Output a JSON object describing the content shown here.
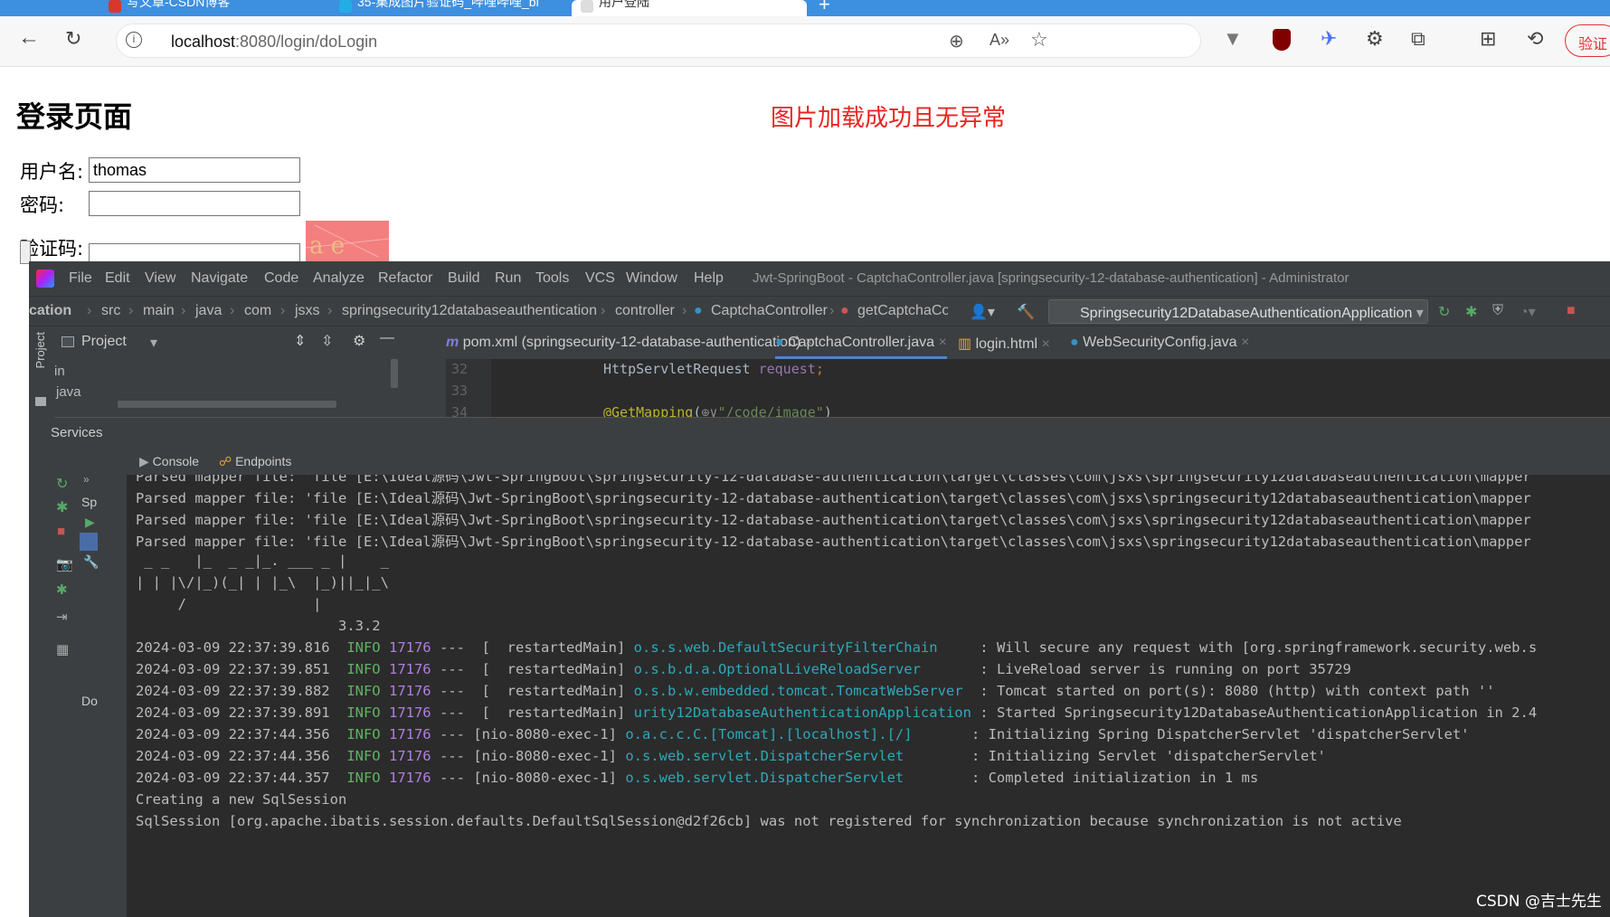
{
  "browser": {
    "tabs": [
      {
        "label": "写文章-CSDN博客",
        "color": "#d9372b"
      },
      {
        "label": "35-集成图片验证码_哔哩哔哩_bi",
        "color": "#23ade5"
      },
      {
        "label": "用户登陆",
        "color": "#cccccc"
      }
    ],
    "url_host": "localhost",
    "url_rest": ":8080/login/doLogin",
    "verify_label": "验证"
  },
  "page": {
    "title": "登录页面",
    "message": "图片加载成功且无异常",
    "username_label": "用户名:",
    "username_value": "thomas",
    "password_label": "密码:",
    "captcha_label": "验证码:",
    "captcha_text": "a e"
  },
  "ide": {
    "menu": [
      "File",
      "Edit",
      "View",
      "Navigate",
      "Code",
      "Analyze",
      "Refactor",
      "Build",
      "Run",
      "Tools",
      "VCS",
      "Window",
      "Help"
    ],
    "title": "Jwt-SpringBoot - CaptchaController.java [springsecurity-12-database-authentication] - Administrator",
    "breadcrumbs": [
      "cation",
      "src",
      "main",
      "java",
      "com",
      "jsxs",
      "springsecurity12databaseauthentication",
      "controller",
      "CaptchaController",
      "getCaptchaCod"
    ],
    "run_config": "Springsecurity12DatabaseAuthenticationApplication",
    "project_label": "Project",
    "editor_tabs": [
      "pom.xml (springsecurity-12-database-authentication)",
      "CaptchaController.java",
      "login.html",
      "WebSecurityConfig.java"
    ],
    "tree": [
      "in",
      "java"
    ],
    "code_lines": [
      {
        "num": "32",
        "text": "HttpServletRequest request;"
      },
      {
        "num": "33",
        "text": ""
      },
      {
        "num": "34",
        "text": "@GetMapping(\"/code/image\")"
      }
    ],
    "services_label": "Services",
    "console_label": "Console",
    "endpoints_label": "Endpoints",
    "svc_sp": "Sp",
    "svc_do": "Do",
    "side_project": "Project"
  },
  "console": {
    "mapper_lines": [
      "Parsed mapper file: 'file [E:\\Ideal源码\\Jwt-SpringBoot\\springsecurity-12-database-authentication\\target\\classes\\com\\jsxs\\springsecurity12databaseauthentication\\mapper",
      "Parsed mapper file: 'file [E:\\Ideal源码\\Jwt-SpringBoot\\springsecurity-12-database-authentication\\target\\classes\\com\\jsxs\\springsecurity12databaseauthentication\\mapper",
      "Parsed mapper file: 'file [E:\\Ideal源码\\Jwt-SpringBoot\\springsecurity-12-database-authentication\\target\\classes\\com\\jsxs\\springsecurity12databaseauthentication\\mapper",
      "Parsed mapper file: 'file [E:\\Ideal源码\\Jwt-SpringBoot\\springsecurity-12-database-authentication\\target\\classes\\com\\jsxs\\springsecurity12databaseauthentication\\mapper"
    ],
    "banner": [
      " _ _   |_  _ _|_. ___ _ |    _",
      "| | |\\/|_)(_| | |_\\  |_)||_|_\\",
      "     /               |",
      "                        3.3.2"
    ],
    "logs": [
      {
        "ts": "2024-03-09 22:37:39.816",
        "level": "INFO",
        "pid": "17176",
        "thread": "---  [  restartedMain]",
        "logger": "o.s.s.web.DefaultSecurityFilterChain    ",
        "msg": ": Will secure any request with [org.springframework.security.web.s"
      },
      {
        "ts": "2024-03-09 22:37:39.851",
        "level": "INFO",
        "pid": "17176",
        "thread": "---  [  restartedMain]",
        "logger": "o.s.b.d.a.OptionalLiveReloadServer      ",
        "msg": ": LiveReload server is running on port 35729"
      },
      {
        "ts": "2024-03-09 22:37:39.882",
        "level": "INFO",
        "pid": "17176",
        "thread": "---  [  restartedMain]",
        "logger": "o.s.b.w.embedded.tomcat.TomcatWebServer ",
        "msg": ": Tomcat started on port(s): 8080 (http) with context path ''"
      },
      {
        "ts": "2024-03-09 22:37:39.891",
        "level": "INFO",
        "pid": "17176",
        "thread": "---  [  restartedMain]",
        "logger": "urity12DatabaseAuthenticationApplication",
        "msg": ": Started Springsecurity12DatabaseAuthenticationApplication in 2.4"
      },
      {
        "ts": "2024-03-09 22:37:44.356",
        "level": "INFO",
        "pid": "17176",
        "thread": "--- [nio-8080-exec-1]",
        "logger": "o.a.c.c.C.[Tomcat].[localhost].[/]      ",
        "msg": ": Initializing Spring DispatcherServlet 'dispatcherServlet'"
      },
      {
        "ts": "2024-03-09 22:37:44.356",
        "level": "INFO",
        "pid": "17176",
        "thread": "--- [nio-8080-exec-1]",
        "logger": "o.s.web.servlet.DispatcherServlet       ",
        "msg": ": Initializing Servlet 'dispatcherServlet'"
      },
      {
        "ts": "2024-03-09 22:37:44.357",
        "level": "INFO",
        "pid": "17176",
        "thread": "--- [nio-8080-exec-1]",
        "logger": "o.s.web.servlet.DispatcherServlet       ",
        "msg": ": Completed initialization in 1 ms"
      }
    ],
    "tail": [
      "Creating a new SqlSession",
      "SqlSession [org.apache.ibatis.session.defaults.DefaultSqlSession@d2f26cb] was not registered for synchronization because synchronization is not active"
    ]
  },
  "watermark": "CSDN @吉士先生"
}
